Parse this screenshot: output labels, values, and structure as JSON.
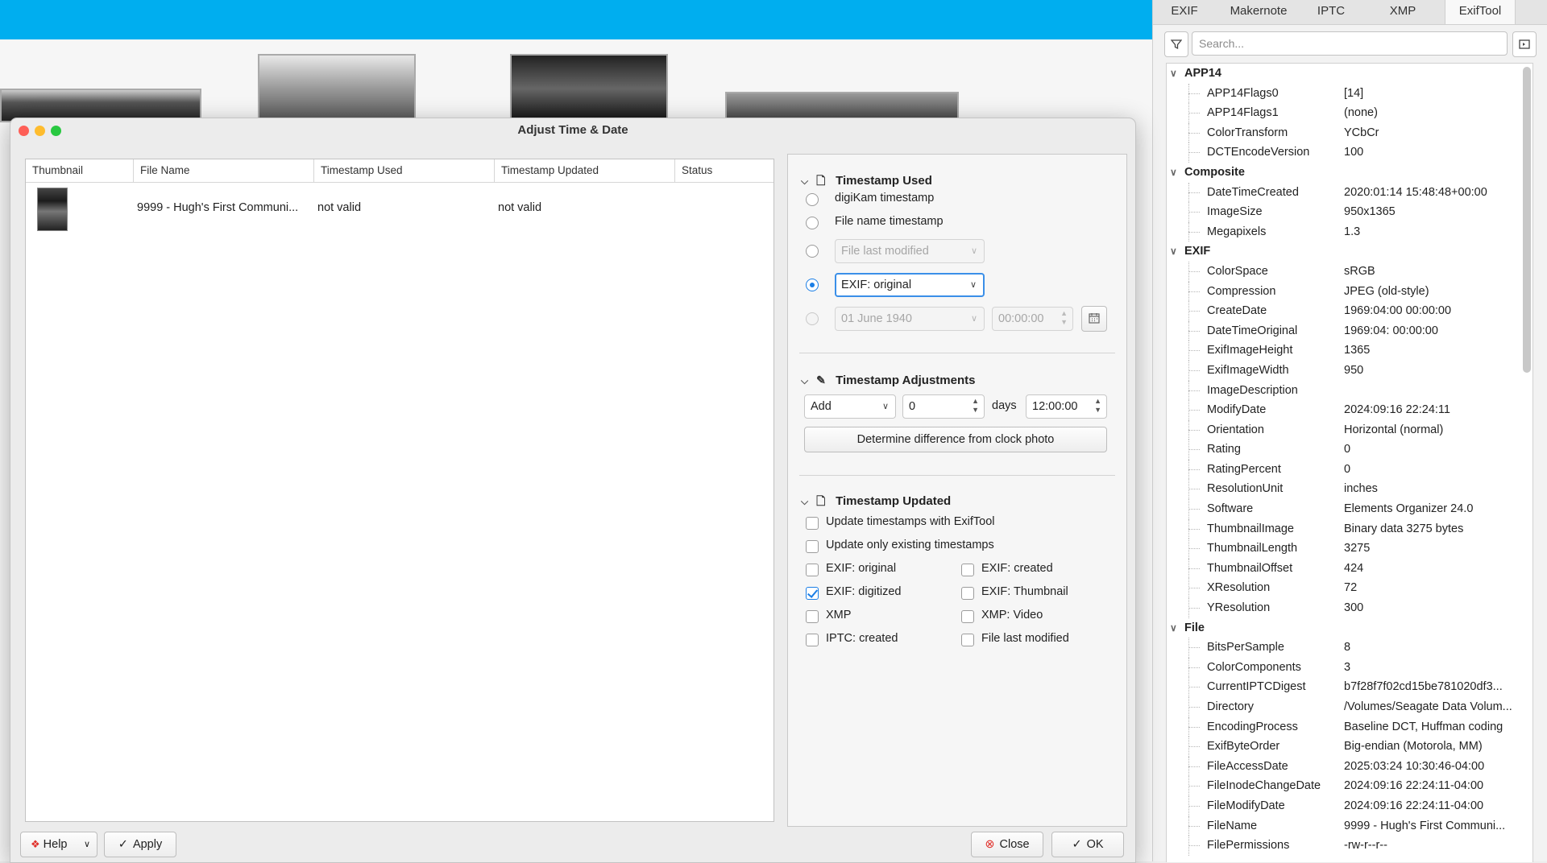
{
  "colors": {
    "app_bar": "#00aeef",
    "accent": "#1a7ee6"
  },
  "meta_tabs": [
    "EXIF",
    "Makernote",
    "IPTC",
    "XMP",
    "ExifTool"
  ],
  "meta_active_tab": "ExifTool",
  "meta_search_placeholder": "Search...",
  "meta": {
    "g0": {
      "name": "APP14",
      "rows": [
        [
          "APP14Flags0",
          "[14]"
        ],
        [
          "APP14Flags1",
          "(none)"
        ],
        [
          "ColorTransform",
          "YCbCr"
        ],
        [
          "DCTEncodeVersion",
          "100"
        ]
      ]
    },
    "g1": {
      "name": "Composite",
      "rows": [
        [
          "DateTimeCreated",
          "2020:01:14 15:48:48+00:00"
        ],
        [
          "ImageSize",
          "950x1365"
        ],
        [
          "Megapixels",
          "1.3"
        ]
      ]
    },
    "g2": {
      "name": "EXIF",
      "rows": [
        [
          "ColorSpace",
          "sRGB"
        ],
        [
          "Compression",
          "JPEG (old-style)"
        ],
        [
          "CreateDate",
          "1969:04:00 00:00:00"
        ],
        [
          "DateTimeOriginal",
          "1969:04: 00:00:00"
        ],
        [
          "ExifImageHeight",
          "1365"
        ],
        [
          "ExifImageWidth",
          "950"
        ],
        [
          "ImageDescription",
          ""
        ],
        [
          "ModifyDate",
          "2024:09:16 22:24:11"
        ],
        [
          "Orientation",
          "Horizontal (normal)"
        ],
        [
          "Rating",
          "0"
        ],
        [
          "RatingPercent",
          "0"
        ],
        [
          "ResolutionUnit",
          "inches"
        ],
        [
          "Software",
          "Elements Organizer 24.0"
        ],
        [
          "ThumbnailImage",
          "Binary data 3275 bytes"
        ],
        [
          "ThumbnailLength",
          "3275"
        ],
        [
          "ThumbnailOffset",
          "424"
        ],
        [
          "XResolution",
          "72"
        ],
        [
          "YResolution",
          "300"
        ]
      ]
    },
    "g3": {
      "name": "File",
      "rows": [
        [
          "BitsPerSample",
          "8"
        ],
        [
          "ColorComponents",
          "3"
        ],
        [
          "CurrentIPTCDigest",
          "b7f28f7f02cd15be781020df3..."
        ],
        [
          "Directory",
          "/Volumes/Seagate Data Volum..."
        ],
        [
          "EncodingProcess",
          "Baseline DCT, Huffman coding"
        ],
        [
          "ExifByteOrder",
          "Big-endian (Motorola, MM)"
        ],
        [
          "FileAccessDate",
          "2025:03:24 10:30:46-04:00"
        ],
        [
          "FileInodeChangeDate",
          "2024:09:16 22:24:11-04:00"
        ],
        [
          "FileModifyDate",
          "2024:09:16 22:24:11-04:00"
        ],
        [
          "FileName",
          "9999 - Hugh's First Communi..."
        ],
        [
          "FilePermissions",
          "-rw-r--r--"
        ]
      ]
    }
  },
  "dialog": {
    "title": "Adjust Time & Date",
    "columns": [
      "Thumbnail",
      "File Name",
      "Timestamp Used",
      "Timestamp Updated",
      "Status"
    ],
    "row": {
      "file_name": "9999 - Hugh's First Communi...",
      "used": "not valid",
      "updated": "not valid",
      "status": ""
    },
    "ts_used": {
      "title": "Timestamp Used",
      "digikam": "digiKam timestamp",
      "filename": "File name timestamp",
      "file_modified": "File last modified",
      "exif_source": "EXIF: original",
      "custom_date": "01 June 1940",
      "custom_time": "00:00:00"
    },
    "adjust": {
      "title": "Timestamp Adjustments",
      "mode": "Add",
      "days_value": "0",
      "days_label": "days",
      "time": "12:00:00",
      "clock_button": "Determine difference from clock photo"
    },
    "updated": {
      "title": "Timestamp Updated",
      "with_exiftool": "Update timestamps with ExifTool",
      "only_existing": "Update only existing timestamps",
      "exif_original": "EXIF: original",
      "exif_created": "EXIF: created",
      "exif_digitized": "EXIF: digitized",
      "exif_thumbnail": "EXIF: Thumbnail",
      "xmp": "XMP",
      "xmp_video": "XMP: Video",
      "iptc_created": "IPTC: created",
      "file_modified": "File last modified"
    },
    "buttons": {
      "help": "Help",
      "apply": "Apply",
      "close": "Close",
      "ok": "OK"
    }
  }
}
